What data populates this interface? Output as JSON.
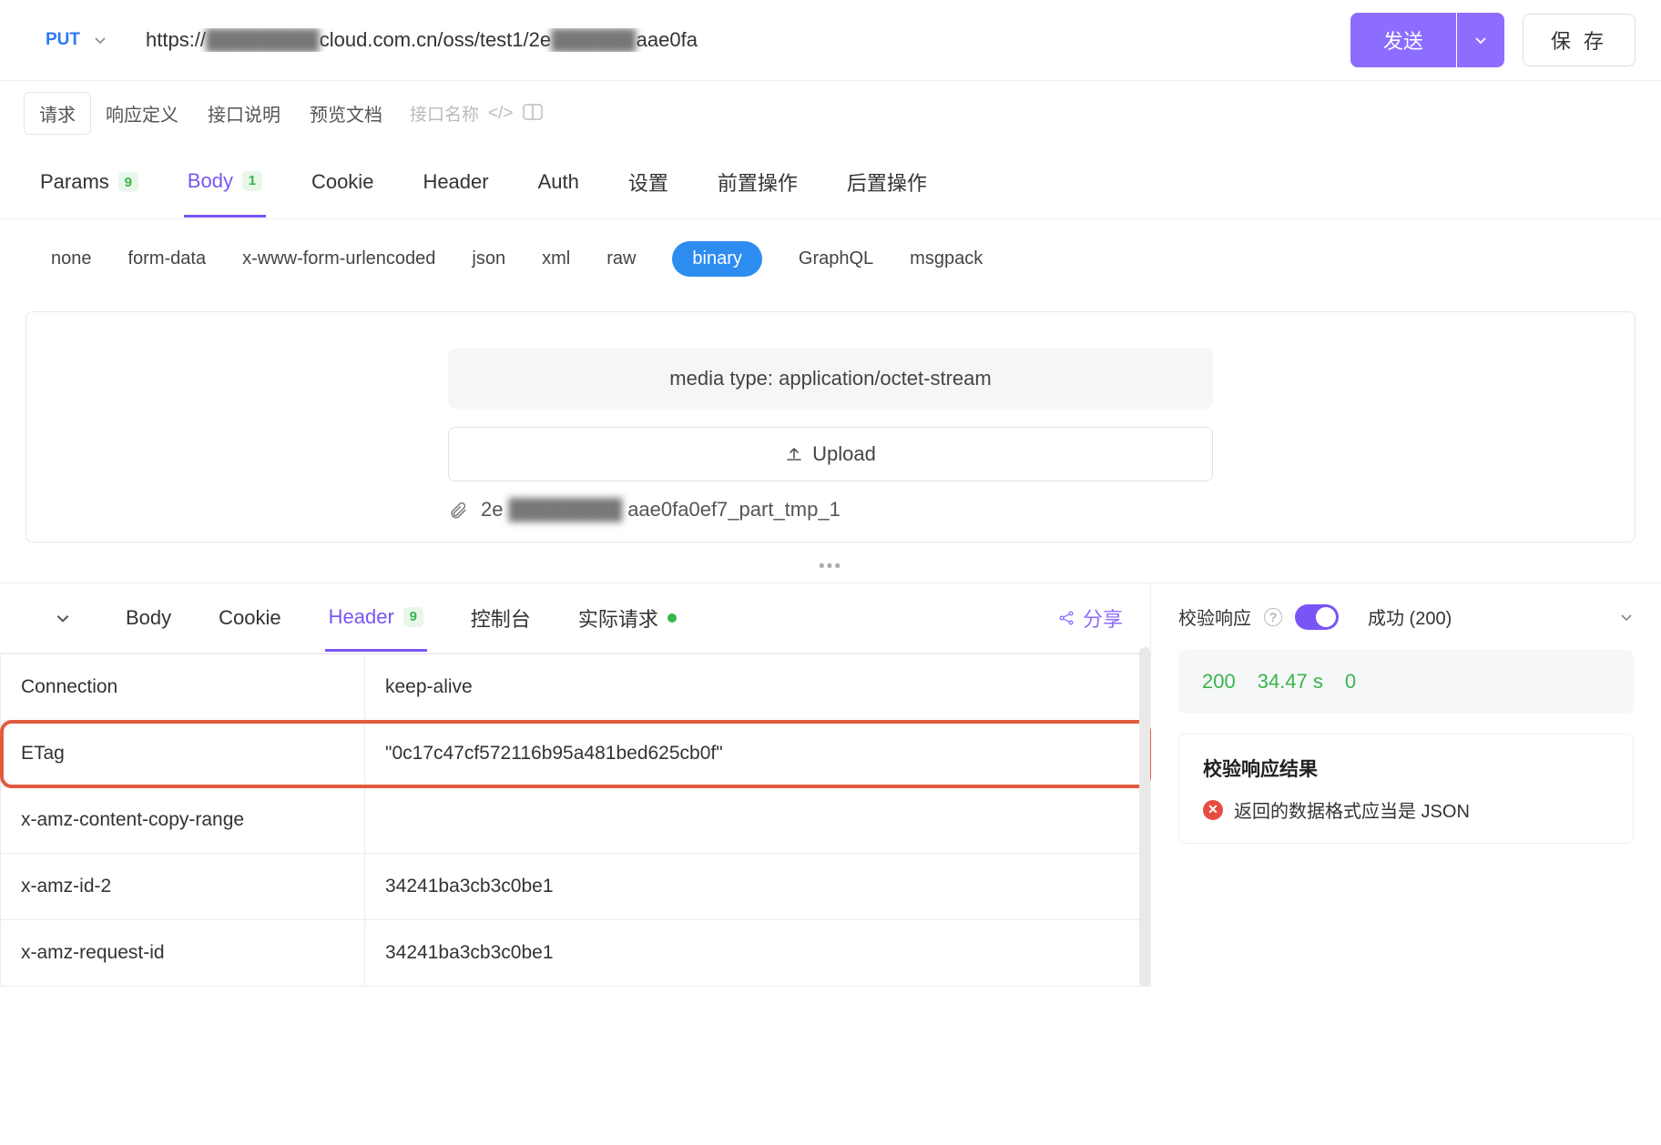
{
  "request": {
    "method": "PUT",
    "url_prefix": "https://",
    "url_blur1": "████████",
    "url_mid": "cloud.com.cn/oss/test1/2e",
    "url_blur2": "██████",
    "url_suffix": "aae0fa",
    "send_label": "发送",
    "save_label": "保 存"
  },
  "toolbar": {
    "tab_request": "请求",
    "tab_response_def": "响应定义",
    "tab_api_desc": "接口说明",
    "tab_preview_doc": "预览文档",
    "ghost_name": "接口名称"
  },
  "req_tabs": {
    "params": "Params",
    "params_badge": "9",
    "body": "Body",
    "body_badge": "1",
    "cookie": "Cookie",
    "header": "Header",
    "auth": "Auth",
    "settings": "设置",
    "pre_op": "前置操作",
    "post_op": "后置操作"
  },
  "body_types": {
    "none": "none",
    "form_data": "form-data",
    "xwww": "x-www-form-urlencoded",
    "json": "json",
    "xml": "xml",
    "raw": "raw",
    "binary": "binary",
    "graphql": "GraphQL",
    "msgpack": "msgpack"
  },
  "body_content": {
    "media_type": "media type: application/octet-stream",
    "upload_label": "Upload",
    "file_prefix": "2e",
    "file_blur": "████████",
    "file_suffix": "aae0fa0ef7_part_tmp_1"
  },
  "resp_tabs": {
    "body": "Body",
    "cookie": "Cookie",
    "header": "Header",
    "header_badge": "9",
    "console": "控制台",
    "actual_req": "实际请求",
    "share": "分享"
  },
  "resp_headers": [
    {
      "k": "Connection",
      "v": "keep-alive"
    },
    {
      "k": "ETag",
      "v": "\"0c17c47cf572116b95a481bed625cb0f\"",
      "hl": true
    },
    {
      "k": "x-amz-content-copy-range",
      "v": ""
    },
    {
      "k": "x-amz-id-2",
      "v": "34241ba3cb3c0be1"
    },
    {
      "k": "x-amz-request-id",
      "v": "34241ba3cb3c0be1"
    }
  ],
  "validate": {
    "label": "校验响应",
    "status_select": "成功 (200)"
  },
  "status": {
    "code": "200",
    "time": "34.47 s",
    "size": "0"
  },
  "result": {
    "title": "校验响应结果",
    "error": "返回的数据格式应当是 JSON"
  }
}
